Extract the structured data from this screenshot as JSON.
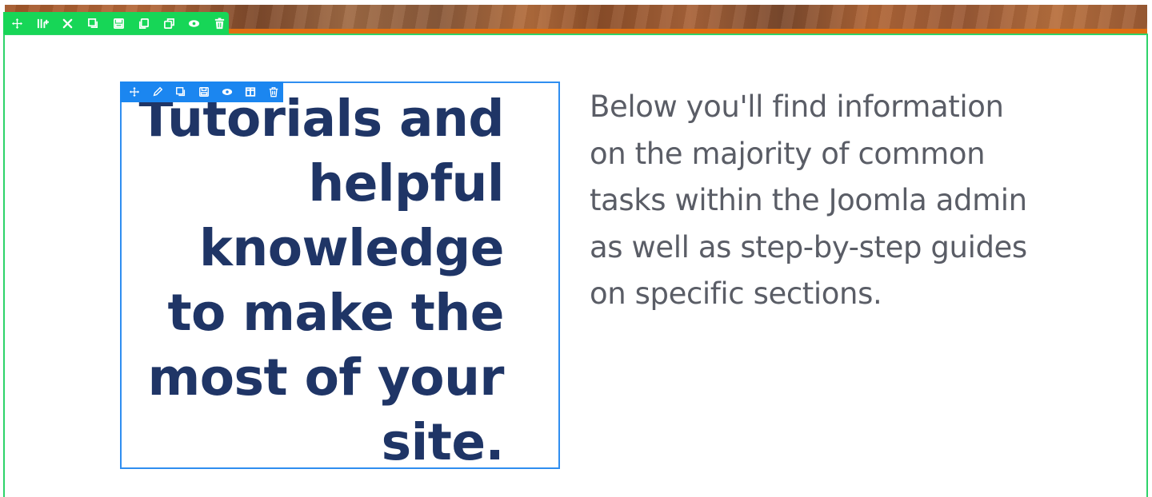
{
  "section_toolbar": {
    "icons": [
      "move-icon",
      "columns-icon",
      "settings-icon",
      "duplicate-icon",
      "save-icon",
      "copy-icon",
      "paste-icon",
      "hide-icon",
      "delete-icon"
    ]
  },
  "module_toolbar": {
    "icons": [
      "move-icon",
      "edit-icon",
      "duplicate-icon",
      "save-icon",
      "hide-icon",
      "layout-icon",
      "delete-icon"
    ]
  },
  "content": {
    "heading": "Tutorials and helpful knowledge to make the most of your site.",
    "description": "Below you'll find information on the majority of common tasks within the Joomla admin as well as step-by-step guides on specific sections."
  },
  "colors": {
    "section_outline": "#2ed36a",
    "module_outline": "#2f8ef0",
    "heading": "#1f3566",
    "body_text": "#5a5d66"
  }
}
